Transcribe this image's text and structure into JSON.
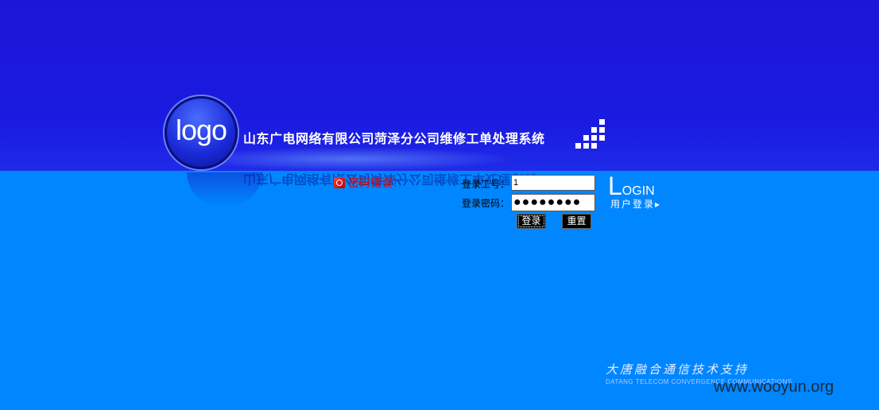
{
  "header": {
    "logo_text": "logo",
    "system_title": "山东广电网络有限公司菏泽分公司维修工单处理系统"
  },
  "error": {
    "message": "密码错误！",
    "icon": "error-icon"
  },
  "login_form": {
    "user_id_label": "登录工号：",
    "user_id_value": "1",
    "password_label": "登录密码：",
    "password_value": "●●●●●●●●",
    "login_button": "登录",
    "reset_button": "重置"
  },
  "login_badge": {
    "big_letter": "L",
    "rest": "OGIN",
    "subtitle": "用户登录▸"
  },
  "footer": {
    "support_cn": "大唐融合通信技术支持",
    "support_en": "DATANG TELECOM CONVERGENCE COMMUNICATIONS",
    "watermark": "www.wooyun.org"
  },
  "colors": {
    "top_band": "#1a1ae0",
    "background": "#0086ff",
    "error": "#e00000"
  }
}
